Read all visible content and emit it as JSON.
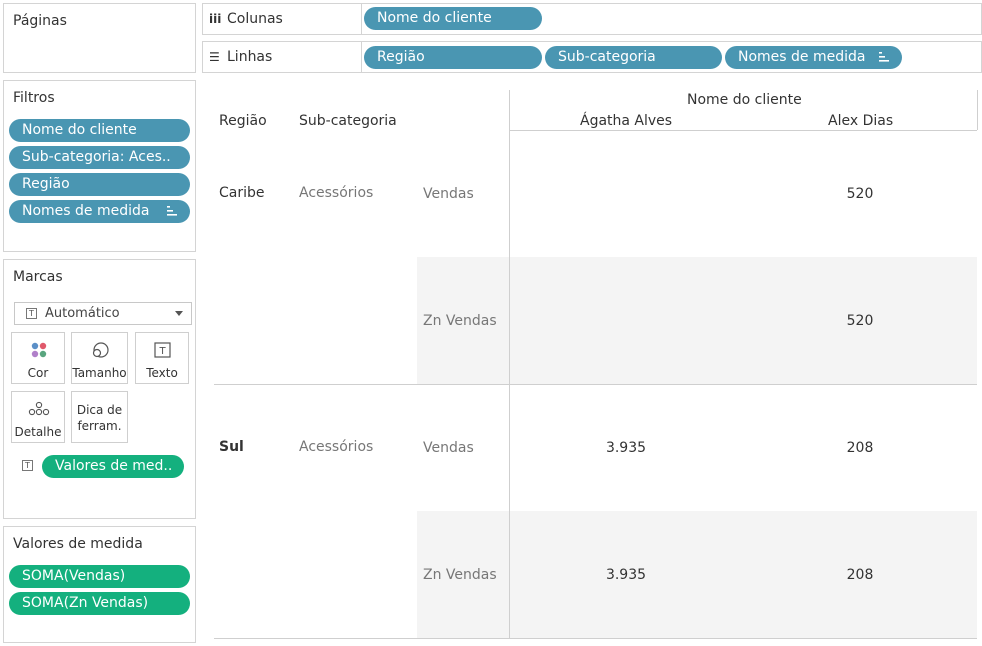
{
  "pages": {
    "title": "Páginas"
  },
  "columns_shelf": {
    "label": "Colunas",
    "icon": "iii",
    "pills": [
      "Nome do cliente"
    ]
  },
  "rows_shelf": {
    "label": "Linhas",
    "icon": "☰",
    "pills": [
      "Região",
      "Sub-categoria",
      "Nomes de medida"
    ]
  },
  "filters": {
    "title": "Filtros",
    "pills": [
      "Nome do cliente",
      "Sub-categoria: Aces..",
      "Região",
      "Nomes de medida"
    ]
  },
  "marks": {
    "title": "Marcas",
    "type_value": "Automático",
    "buttons": [
      "Cor",
      "Tamanho",
      "Texto",
      "Detalhe",
      "Dica de ferram."
    ],
    "text_pill": "Valores de med..",
    "icons": {
      "color": "dots-icon",
      "size": "size-icon",
      "text": "text-icon",
      "detail": "detail-icon"
    },
    "dot_colors": [
      "#5b8fc7",
      "#e0596b",
      "#b07fc9",
      "#59a57f"
    ]
  },
  "measure_values": {
    "title": "Valores de medida",
    "pills": [
      "SOMA(Vendas)",
      "SOMA(Zn Vendas)"
    ]
  },
  "colors": {
    "dimension_pill": "#4a96b2",
    "measure_pill": "#14b07e"
  },
  "table": {
    "column_field": "Nome do cliente",
    "row_headers": [
      "Região",
      "Sub-categoria"
    ],
    "columns": [
      "Ágatha Alves",
      "Alex Dias"
    ],
    "regions": [
      {
        "region": "Caribe",
        "subcategory": "Acessórios",
        "rows": [
          {
            "measure": "Vendas",
            "values": [
              "",
              "520"
            ]
          },
          {
            "measure": "Zn Vendas",
            "values": [
              "",
              "520"
            ]
          }
        ]
      },
      {
        "region": "Sul",
        "subcategory": "Acessórios",
        "rows": [
          {
            "measure": "Vendas",
            "values": [
              "3.935",
              "208"
            ]
          },
          {
            "measure": "Zn Vendas",
            "values": [
              "3.935",
              "208"
            ]
          }
        ]
      }
    ]
  }
}
